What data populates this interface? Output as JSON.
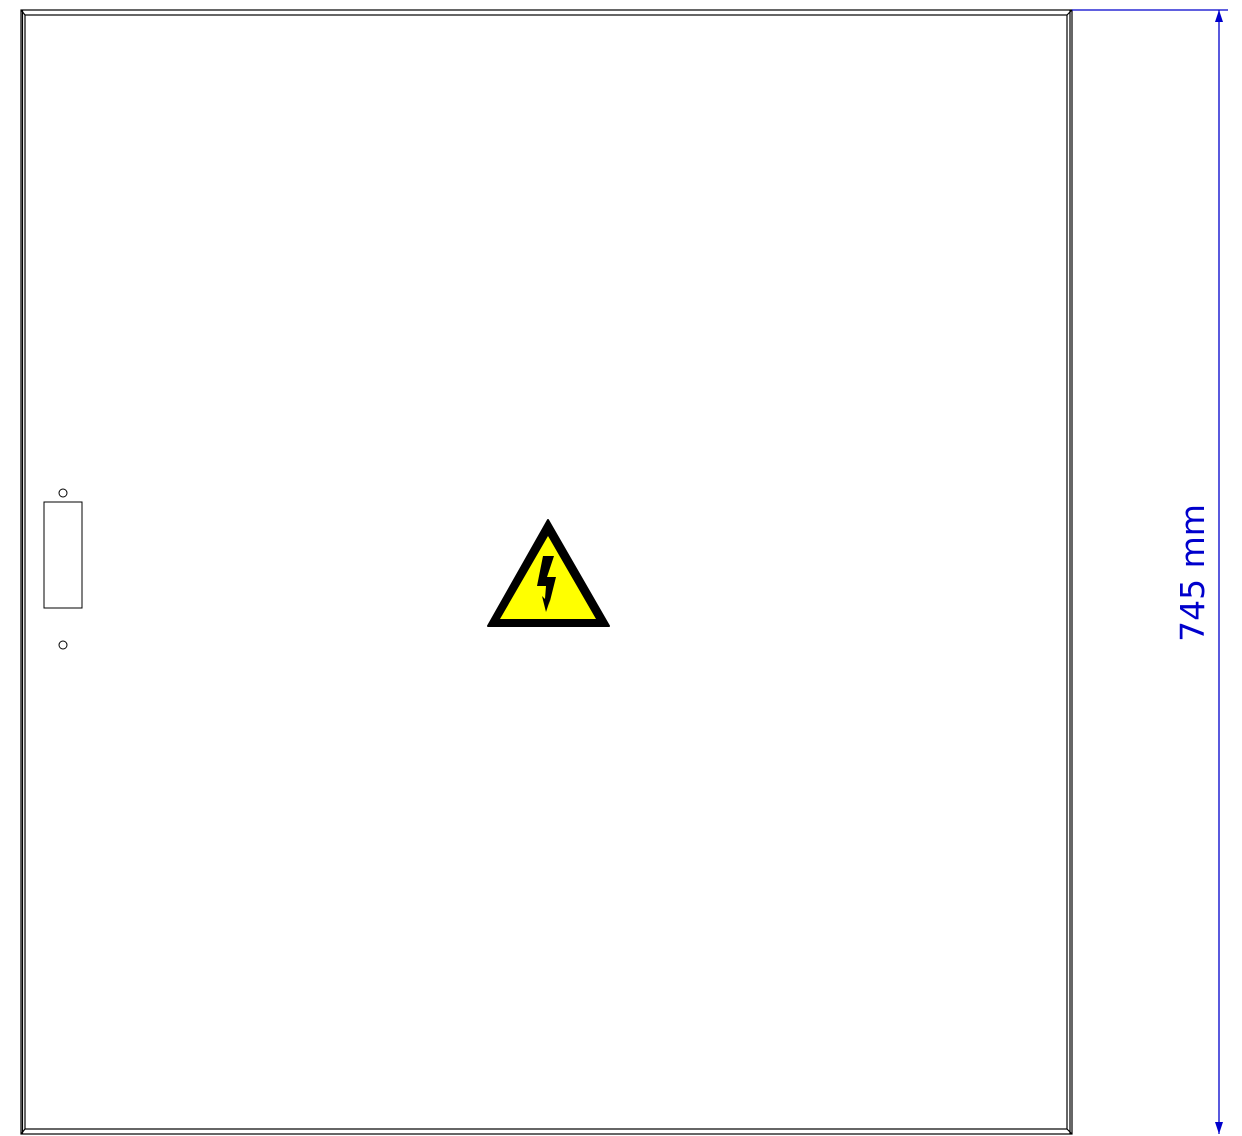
{
  "dimension": {
    "label": "745 mm",
    "color": "#0000cc"
  },
  "warning_sign": {
    "icon": "high-voltage-warning-icon",
    "fill_color": "#ffff00",
    "border_color": "#000000"
  },
  "line_color": "#000000"
}
